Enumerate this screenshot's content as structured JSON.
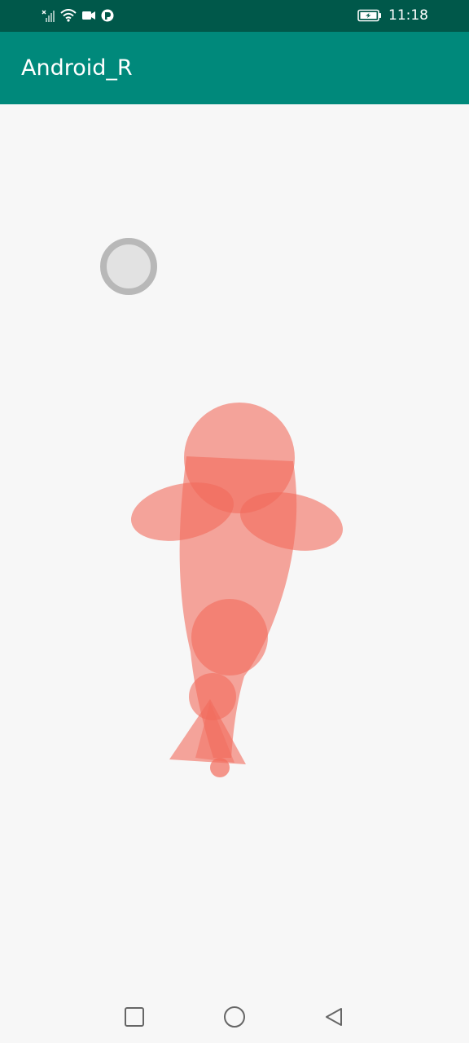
{
  "status_bar": {
    "time": "11:18",
    "icons": [
      "signal-x-icon",
      "wifi-icon",
      "video-camera-icon",
      "app-notification-icon",
      "battery-charging-icon"
    ]
  },
  "app_bar": {
    "title": "Android_R"
  },
  "canvas": {
    "content": "animated-fish-drawing",
    "fish_color": "#f26b5b",
    "ripple_color": "#b8b8b8"
  },
  "nav_bar": {
    "buttons": [
      "recents-button",
      "home-button",
      "back-button"
    ]
  },
  "colors": {
    "status_bar": "#00584a",
    "app_bar": "#00897b",
    "background": "#f7f7f7"
  }
}
